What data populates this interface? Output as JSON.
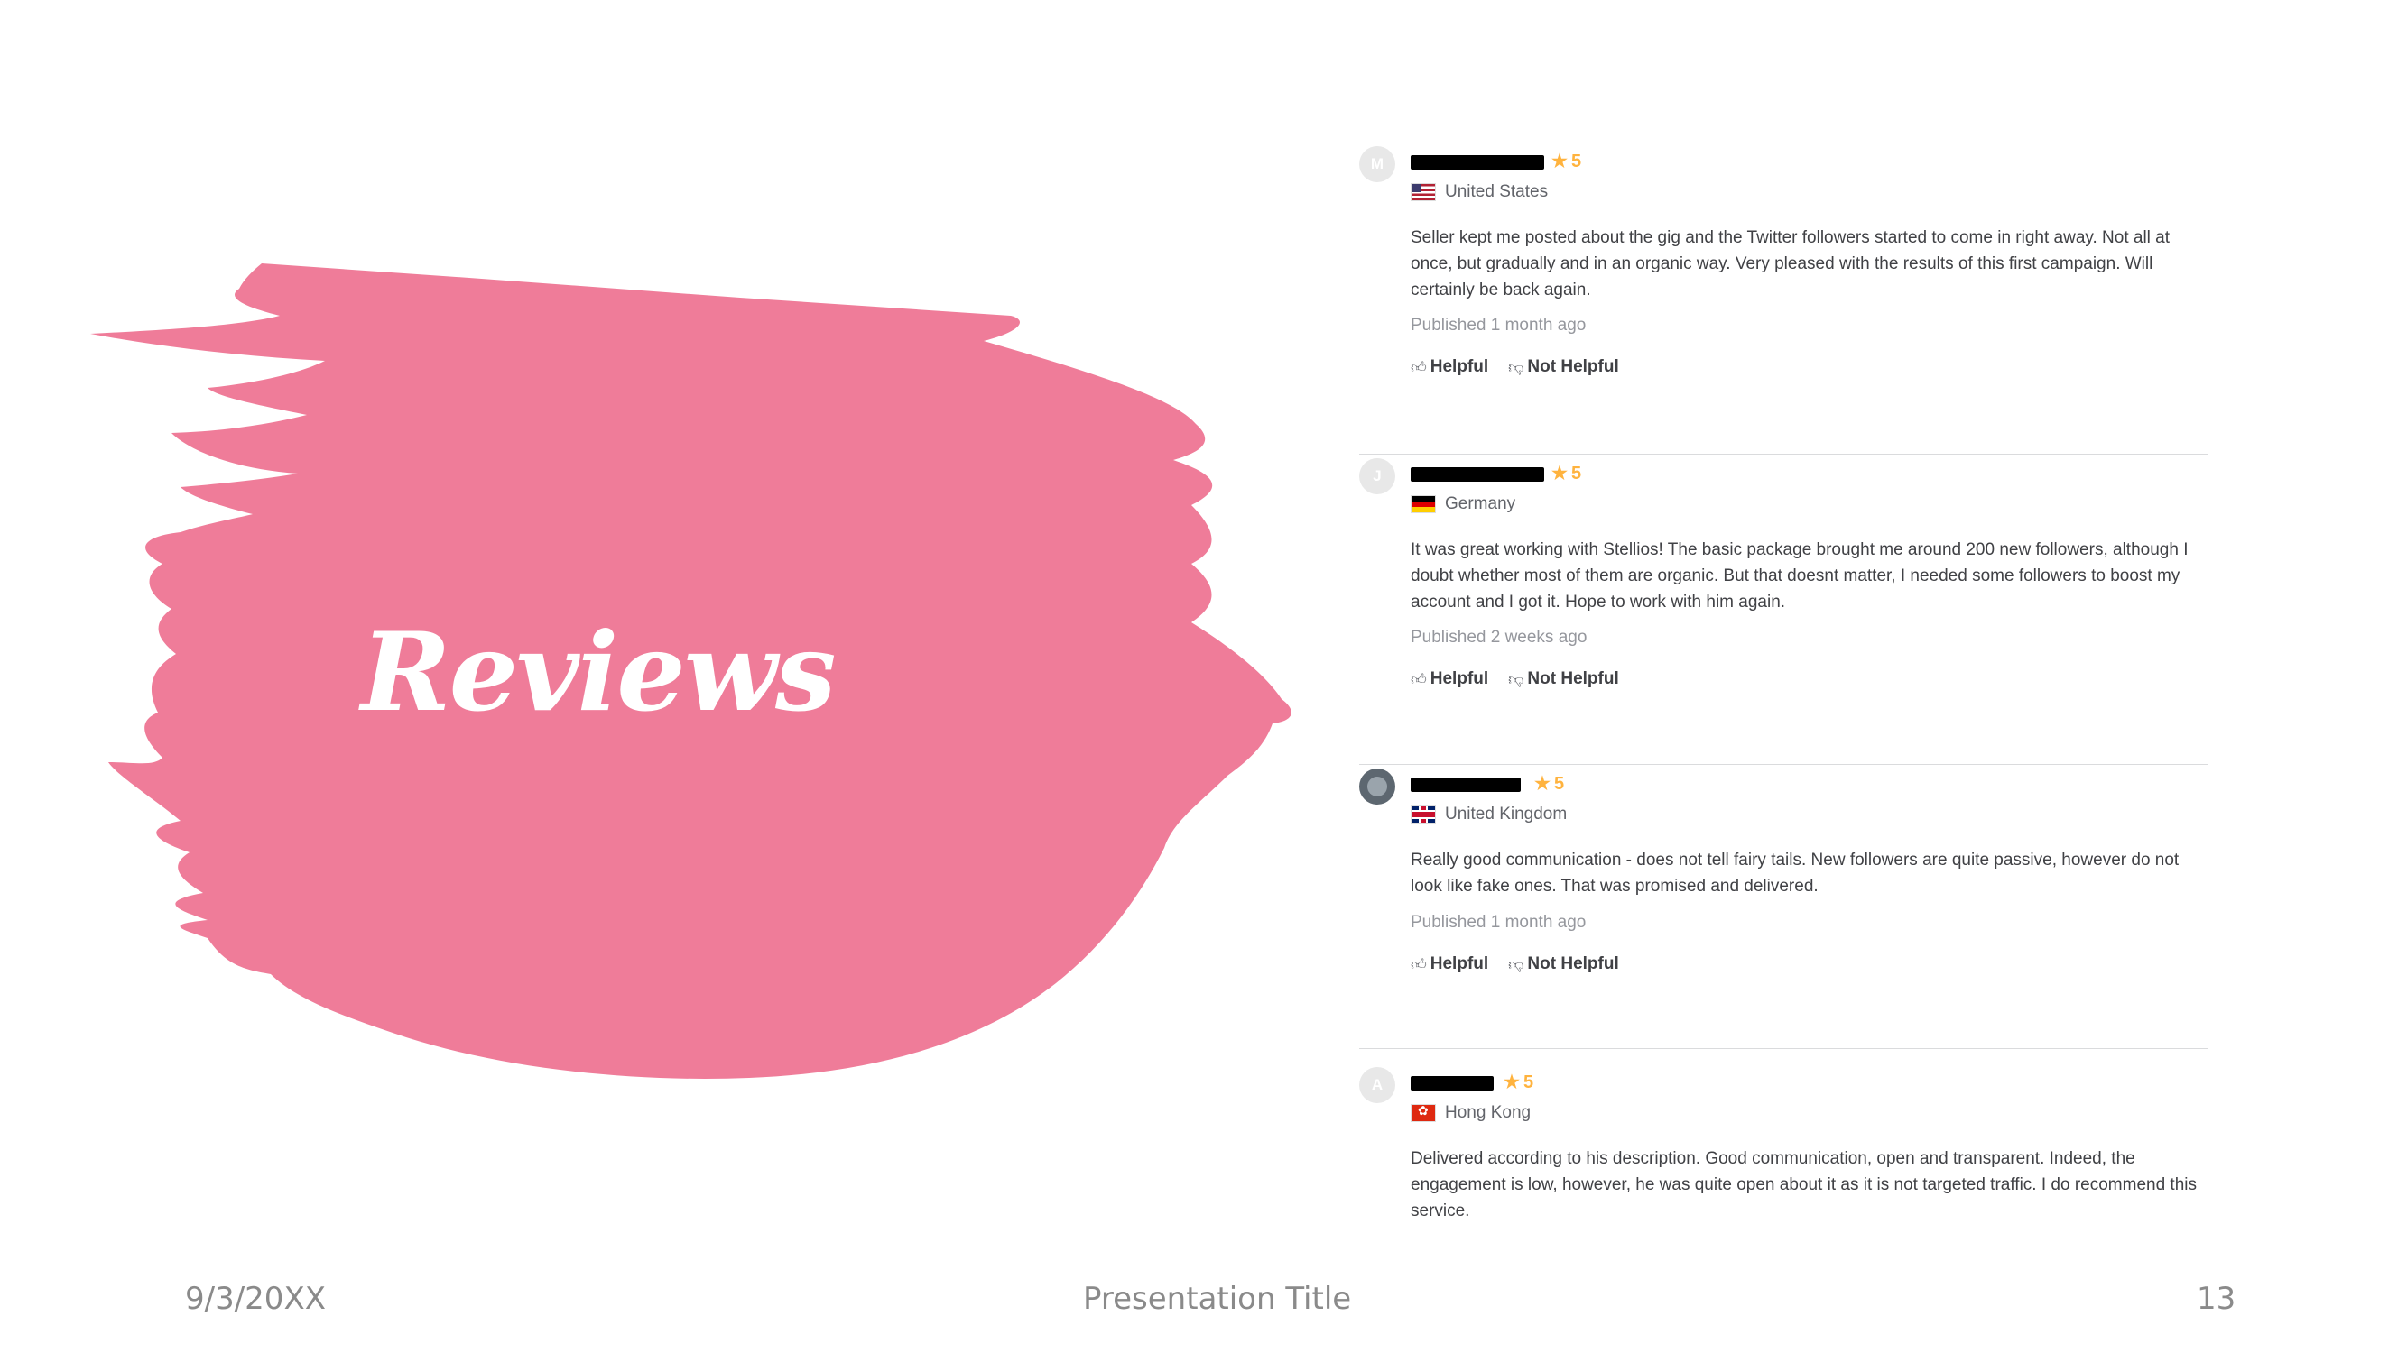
{
  "slide": {
    "title": "Reviews",
    "accent_color": "#ef7c99",
    "footer": {
      "date": "9/3/20XX",
      "presentation_title": "Presentation Title",
      "page_number": "13"
    }
  },
  "reviews": [
    {
      "avatar_letter": "M",
      "rating": "5",
      "country": "United States",
      "flag": "us-flag",
      "body": "Seller kept me posted about the gig and the Twitter followers started to come in right away. Not all at once, but gradually and in an organic way. Very pleased with the results of this first campaign. Will certainly be back again.",
      "published": "Published 1 month ago",
      "helpful_label": "Helpful",
      "not_helpful_label": "Not Helpful"
    },
    {
      "avatar_letter": "J",
      "rating": "5",
      "country": "Germany",
      "flag": "germany-flag",
      "body": "It was great working with Stellios! The basic package brought me around 200 new followers, although I doubt whether most of them are organic. But that doesnt matter, I needed some followers to boost my account and I got it. Hope to work with him again.",
      "published": "Published 2 weeks ago",
      "helpful_label": "Helpful",
      "not_helpful_label": "Not Helpful"
    },
    {
      "avatar_letter": "",
      "rating": "5",
      "country": "United Kingdom",
      "flag": "uk-flag",
      "body": "Really good communication - does not tell fairy tails. New followers are quite passive, however do not look like fake ones. That was promised and delivered.",
      "published": "Published 1 month ago",
      "helpful_label": "Helpful",
      "not_helpful_label": "Not Helpful"
    },
    {
      "avatar_letter": "A",
      "rating": "5",
      "country": "Hong Kong",
      "flag": "hong-kong-flag",
      "body": "Delivered according to his description. Good communication, open and transparent. Indeed, the engagement is low, however, he was quite open about it as it is not targeted traffic. I do recommend this service.",
      "published": "",
      "helpful_label": "",
      "not_helpful_label": ""
    }
  ]
}
